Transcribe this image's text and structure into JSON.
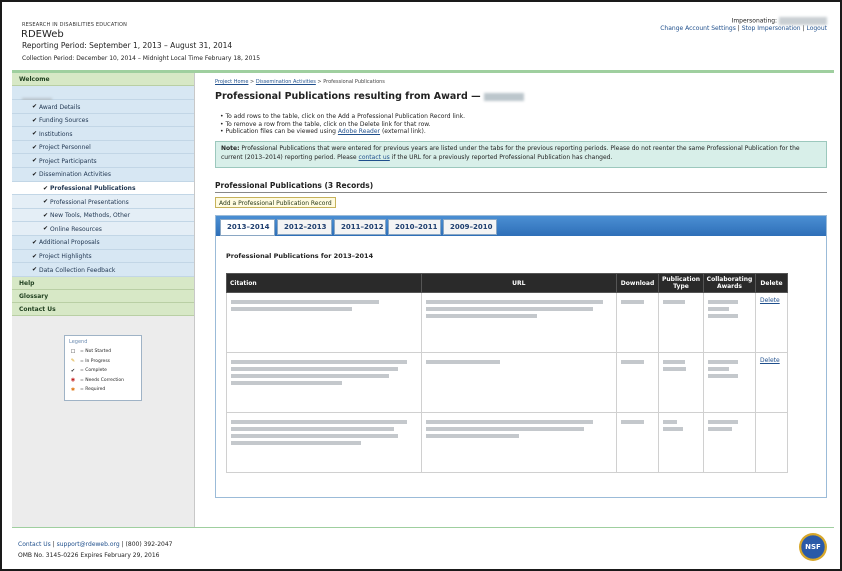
{
  "header": {
    "org": "RESEARCH IN DISABILITIES EDUCATION",
    "app_title": "RDEWeb",
    "reporting_period": "Reporting Period: September 1, 2013 – August 31, 2014",
    "collection_period": "Collection Period: December 10, 2014 – Midnight Local Time February 18, 2015",
    "impersonating_label": "Impersonating:",
    "change_settings": "Change Account Settings",
    "stop_impersonation": "Stop Impersonation",
    "logout": "Logout"
  },
  "sidebar": {
    "welcome": "Welcome",
    "items": [
      {
        "label": "Award Details",
        "sub": false
      },
      {
        "label": "Funding Sources",
        "sub": false
      },
      {
        "label": "Institutions",
        "sub": false
      },
      {
        "label": "Project Personnel",
        "sub": false
      },
      {
        "label": "Project Participants",
        "sub": false
      },
      {
        "label": "Dissemination Activities",
        "sub": false
      },
      {
        "label": "Professional Publications",
        "sub": true
      },
      {
        "label": "Professional Presentations",
        "sub": true
      },
      {
        "label": "New Tools, Methods, Other",
        "sub": true
      },
      {
        "label": "Online Resources",
        "sub": true
      },
      {
        "label": "Additional Proposals",
        "sub": false
      },
      {
        "label": "Project Highlights",
        "sub": false
      },
      {
        "label": "Data Collection Feedback",
        "sub": false
      }
    ],
    "help": "Help",
    "glossary": "Glossary",
    "contact": "Contact Us"
  },
  "legend": {
    "title": "Legend",
    "items": [
      "= Not Started",
      "= In Progress",
      "= Complete",
      "= Needs Correction",
      "= Required"
    ]
  },
  "main": {
    "crumbs": [
      "Project Home",
      "Dissemination Activities",
      "Professional Publications"
    ],
    "title": "Professional Publications resulting from Award —",
    "instructions": [
      "To add rows to the table, click on the Add a Professional Publication Record link.",
      "To remove a row from the table, click on the Delete link for that row.",
      "Publication files can be viewed using",
      "Adobe Reader",
      "(external link)."
    ],
    "note_label": "Note:",
    "note_text": "Professional Publications that were entered for previous years are listed under the tabs for the previous reporting periods. Please do not reenter the same Professional Publication for the current (2013–2014) reporting period. Please",
    "note_link": "contact us",
    "note_tail": "if the URL for a previously reported Professional Publication has changed.",
    "section_title": "Professional Publications (3 Records)",
    "add_button": "Add a Professional Publication Record",
    "tabs": [
      "2013–2014",
      "2012–2013",
      "2011–2012",
      "2010–2011",
      "2009–2010"
    ],
    "table_title": "Professional Publications for 2013–2014",
    "columns": [
      "Citation",
      "URL",
      "Download",
      "Publication Type",
      "Collaborating Awards",
      "Delete"
    ],
    "delete_label": "Delete"
  },
  "footer": {
    "contact": "Contact Us",
    "email": "support@rdeweb.org",
    "phone": "(800) 392-2047",
    "omb": "OMB No. 3145-0226 Expires February 29, 2016",
    "nsf_logo": "NSF"
  }
}
